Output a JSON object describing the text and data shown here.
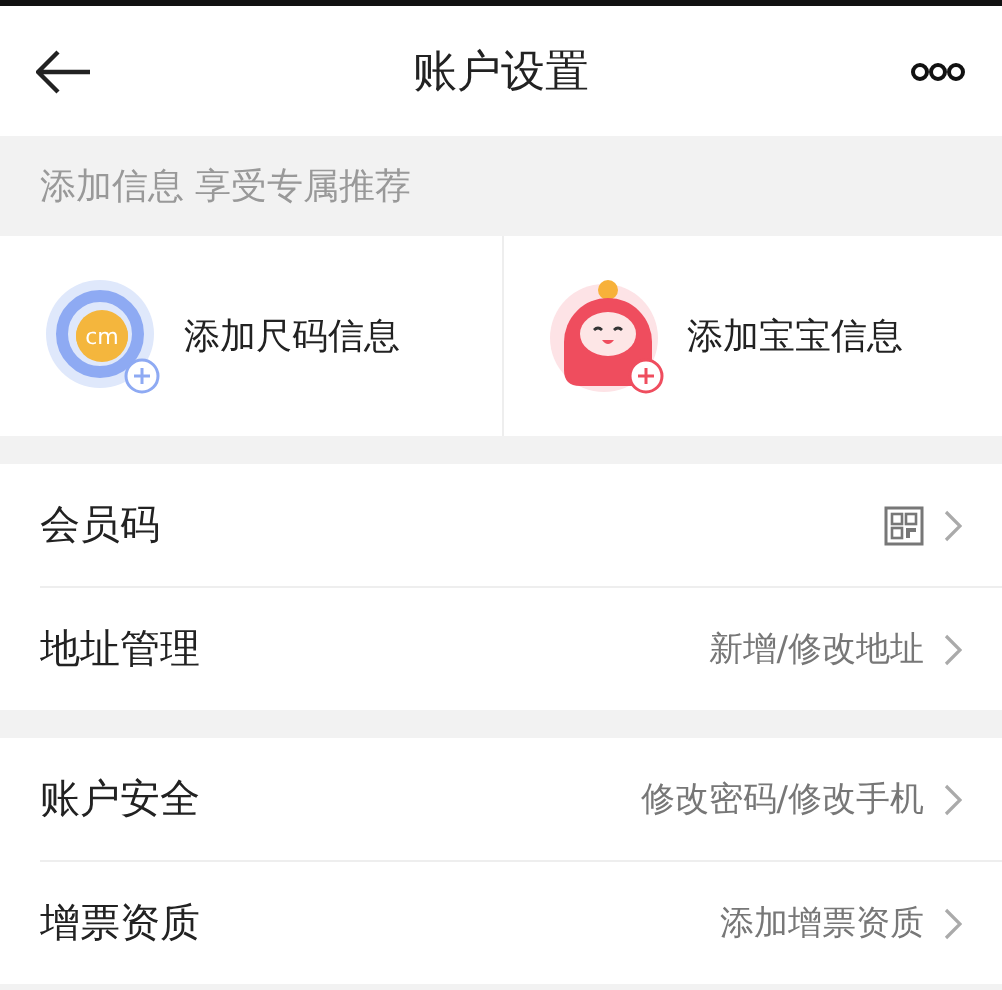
{
  "header": {
    "title": "账户设置"
  },
  "banner": {
    "text": "添加信息 享受专属推荐"
  },
  "cards": [
    {
      "kind": "size",
      "label": "添加尺码信息",
      "badge": "cm"
    },
    {
      "kind": "baby",
      "label": "添加宝宝信息"
    }
  ],
  "sections": [
    [
      {
        "label": "会员码",
        "kind": "qr"
      },
      {
        "label": "地址管理",
        "value": "新增/修改地址"
      }
    ],
    [
      {
        "label": "账户安全",
        "value": "修改密码/修改手机"
      },
      {
        "label": "增票资质",
        "value": "添加增票资质"
      }
    ]
  ]
}
